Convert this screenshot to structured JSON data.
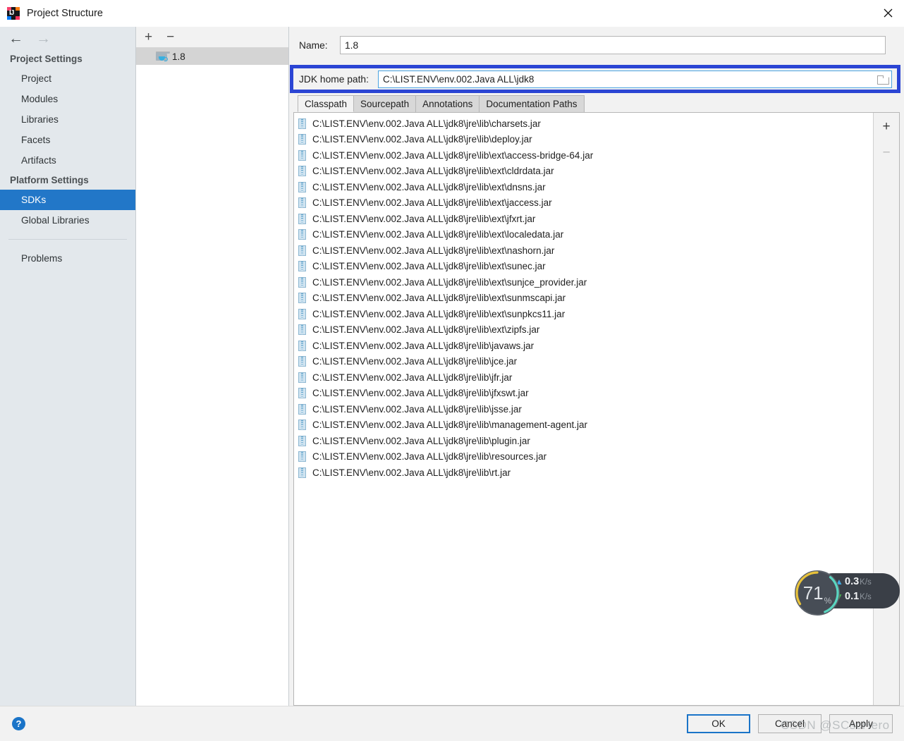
{
  "window": {
    "title": "Project Structure",
    "app_icon": "intellij-idea-icon",
    "close_icon": "close-icon"
  },
  "sidebar": {
    "back_arrow": "←",
    "forward_arrow": "→",
    "groups": [
      {
        "header": "Project Settings",
        "items": [
          {
            "label": "Project",
            "selected": false
          },
          {
            "label": "Modules",
            "selected": false
          },
          {
            "label": "Libraries",
            "selected": false
          },
          {
            "label": "Facets",
            "selected": false
          },
          {
            "label": "Artifacts",
            "selected": false
          }
        ]
      },
      {
        "header": "Platform Settings",
        "items": [
          {
            "label": "SDKs",
            "selected": true
          },
          {
            "label": "Global Libraries",
            "selected": false
          }
        ]
      }
    ],
    "extra_items": [
      {
        "label": "Problems",
        "selected": false
      }
    ]
  },
  "sdk_panel": {
    "add_label": "+",
    "remove_label": "−",
    "items": [
      {
        "label": "1.8",
        "icon": "jdk-folder-icon",
        "selected": true
      }
    ]
  },
  "detail": {
    "name_label": "Name:",
    "name_value": "1.8",
    "name_placeholder": "",
    "jdk_home_label": "JDK home path:",
    "jdk_home_value": "C:\\LIST.ENV\\env.002.Java ALL\\jdk8",
    "jdk_home_placeholder": "",
    "browse_icon": "folder-browse-icon",
    "annotation_color": "#2b45d4",
    "tabs": [
      {
        "label": "Classpath",
        "active": true
      },
      {
        "label": "Sourcepath",
        "active": false
      },
      {
        "label": "Annotations",
        "active": false
      },
      {
        "label": "Documentation Paths",
        "active": false
      }
    ],
    "classpath_add_label": "+",
    "classpath_remove_label": "−",
    "classpath_entries": [
      "C:\\LIST.ENV\\env.002.Java ALL\\jdk8\\jre\\lib\\charsets.jar",
      "C:\\LIST.ENV\\env.002.Java ALL\\jdk8\\jre\\lib\\deploy.jar",
      "C:\\LIST.ENV\\env.002.Java ALL\\jdk8\\jre\\lib\\ext\\access-bridge-64.jar",
      "C:\\LIST.ENV\\env.002.Java ALL\\jdk8\\jre\\lib\\ext\\cldrdata.jar",
      "C:\\LIST.ENV\\env.002.Java ALL\\jdk8\\jre\\lib\\ext\\dnsns.jar",
      "C:\\LIST.ENV\\env.002.Java ALL\\jdk8\\jre\\lib\\ext\\jaccess.jar",
      "C:\\LIST.ENV\\env.002.Java ALL\\jdk8\\jre\\lib\\ext\\jfxrt.jar",
      "C:\\LIST.ENV\\env.002.Java ALL\\jdk8\\jre\\lib\\ext\\localedata.jar",
      "C:\\LIST.ENV\\env.002.Java ALL\\jdk8\\jre\\lib\\ext\\nashorn.jar",
      "C:\\LIST.ENV\\env.002.Java ALL\\jdk8\\jre\\lib\\ext\\sunec.jar",
      "C:\\LIST.ENV\\env.002.Java ALL\\jdk8\\jre\\lib\\ext\\sunjce_provider.jar",
      "C:\\LIST.ENV\\env.002.Java ALL\\jdk8\\jre\\lib\\ext\\sunmscapi.jar",
      "C:\\LIST.ENV\\env.002.Java ALL\\jdk8\\jre\\lib\\ext\\sunpkcs11.jar",
      "C:\\LIST.ENV\\env.002.Java ALL\\jdk8\\jre\\lib\\ext\\zipfs.jar",
      "C:\\LIST.ENV\\env.002.Java ALL\\jdk8\\jre\\lib\\javaws.jar",
      "C:\\LIST.ENV\\env.002.Java ALL\\jdk8\\jre\\lib\\jce.jar",
      "C:\\LIST.ENV\\env.002.Java ALL\\jdk8\\jre\\lib\\jfr.jar",
      "C:\\LIST.ENV\\env.002.Java ALL\\jdk8\\jre\\lib\\jfxswt.jar",
      "C:\\LIST.ENV\\env.002.Java ALL\\jdk8\\jre\\lib\\jsse.jar",
      "C:\\LIST.ENV\\env.002.Java ALL\\jdk8\\jre\\lib\\management-agent.jar",
      "C:\\LIST.ENV\\env.002.Java ALL\\jdk8\\jre\\lib\\plugin.jar",
      "C:\\LIST.ENV\\env.002.Java ALL\\jdk8\\jre\\lib\\resources.jar",
      "C:\\LIST.ENV\\env.002.Java ALL\\jdk8\\jre\\lib\\rt.jar"
    ]
  },
  "footer": {
    "help_label": "?",
    "ok_label": "OK",
    "cancel_label": "Cancel",
    "apply_label": "Apply",
    "accent_color": "#1a74c8"
  },
  "watermark": {
    "text": "CSDN @SCscHero"
  },
  "network_monitor": {
    "percent": "71",
    "percent_symbol": "%",
    "upload_arrow": "▲",
    "upload_value": "0.3",
    "upload_unit": "K/s",
    "download_arrow": "▼",
    "download_value": "0.1",
    "download_unit": "K/s"
  }
}
